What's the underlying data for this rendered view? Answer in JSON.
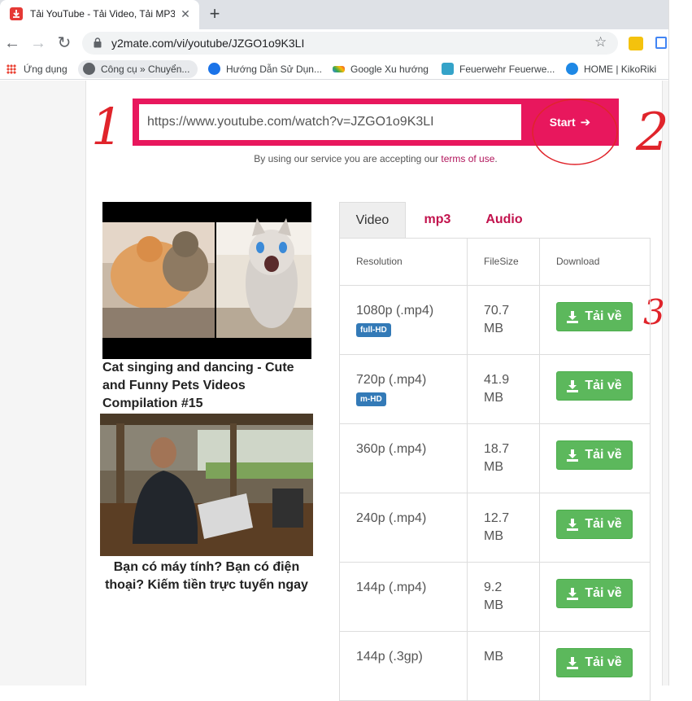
{
  "browser": {
    "tab_title": "Tải YouTube - Tải Video, Tải MP3",
    "tab_close": "✕",
    "new_tab": "+",
    "url": "y2mate.com/vi/youtube/JZGO1o9K3LI",
    "back": "←",
    "forward": "→",
    "reload": "↻",
    "star": "☆",
    "icons": {
      "tab_favicon": "y2mate-download-icon",
      "lock": "lock-icon",
      "star": "star-icon"
    }
  },
  "bookmarks": [
    {
      "label": "Ứng dụng",
      "icon": "apps-grid-icon"
    },
    {
      "label": "Công cụ » Chuyển...",
      "icon": "globe-icon"
    },
    {
      "label": "Hướng Dẫn Sử Dụn...",
      "icon": "l-logo-icon"
    },
    {
      "label": "Google Xu hướng",
      "icon": "trends-icon"
    },
    {
      "label": "Feuerwehr Feuerwe...",
      "icon": "feuerwehr-icon"
    },
    {
      "label": "HOME | KikoRiki",
      "icon": "kikoriki-icon"
    }
  ],
  "search": {
    "value": "https://www.youtube.com/watch?v=JZGO1o9K3LI",
    "start_label": "Start",
    "start_arrow": "➔"
  },
  "terms": {
    "prefix": "By using our service you are accepting our ",
    "link": "terms of use",
    "suffix": "."
  },
  "annotations": {
    "one": "1",
    "two": "2",
    "three": "3"
  },
  "videos": [
    {
      "title": "Cat singing and dancing - Cute and Funny Pets Videos Compilation #15"
    },
    {
      "title": "Bạn có máy tính? Bạn có điện thoại? Kiếm tiền trực tuyến ngay"
    }
  ],
  "result_tabs": [
    {
      "label": "Video",
      "active": true
    },
    {
      "label": "mp3",
      "active": false
    },
    {
      "label": "Audio",
      "active": false
    }
  ],
  "table": {
    "headers": [
      "Resolution",
      "FileSize",
      "Download"
    ],
    "download_label": "Tải về",
    "rows": [
      {
        "resolution": "1080p (.mp4)",
        "badge": "full-HD",
        "size": "70.7 MB"
      },
      {
        "resolution": "720p (.mp4)",
        "badge": "m-HD",
        "size": "41.9 MB"
      },
      {
        "resolution": "360p (.mp4)",
        "badge": "",
        "size": "18.7 MB"
      },
      {
        "resolution": "240p (.mp4)",
        "badge": "",
        "size": "12.7 MB"
      },
      {
        "resolution": "144p (.mp4)",
        "badge": "",
        "size": "9.2 MB"
      },
      {
        "resolution": "144p (.3gp)",
        "badge": "",
        "size": "MB"
      }
    ]
  },
  "colors": {
    "accent": "#e8175d",
    "tab_link": "#c2134d",
    "download_green": "#5cb85c",
    "badge_blue": "#337ab7",
    "annotation_red": "#e0242b"
  }
}
